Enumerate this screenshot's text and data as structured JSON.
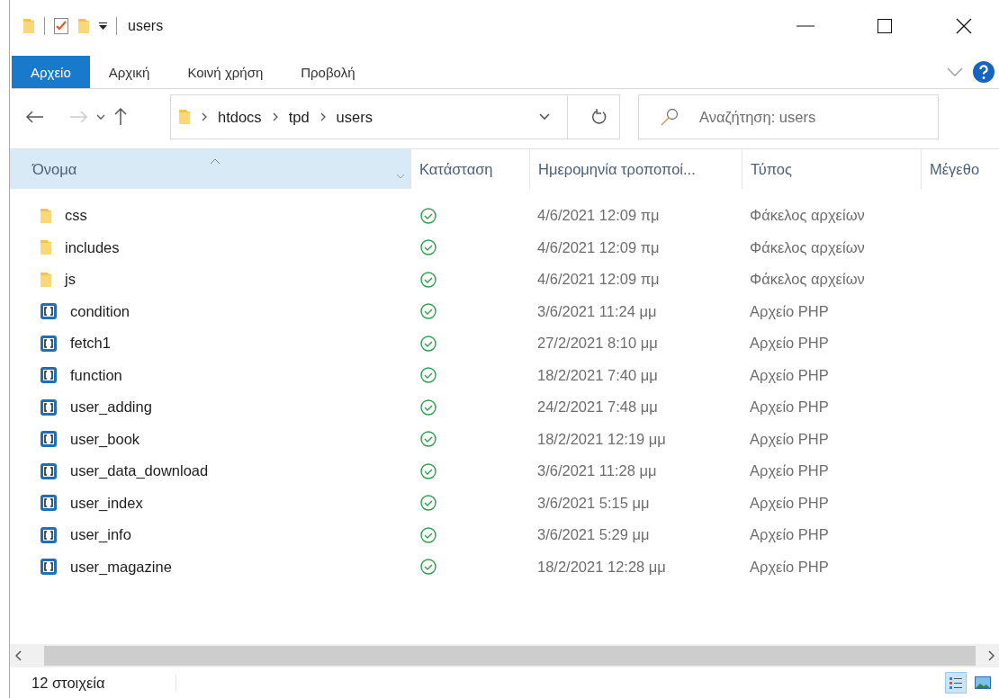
{
  "window": {
    "title": "users"
  },
  "ribbon": {
    "tabs": [
      {
        "label": "Αρχείο",
        "selected": true
      },
      {
        "label": "Αρχική",
        "selected": false
      },
      {
        "label": "Κοινή χρήση",
        "selected": false
      },
      {
        "label": "Προβολή",
        "selected": false
      }
    ]
  },
  "address_bar": {
    "path": [
      "htdocs",
      "tpd",
      "users"
    ]
  },
  "search": {
    "placeholder": "Αναζήτηση: users"
  },
  "table": {
    "columns": [
      {
        "label": "Όνομα",
        "sorted": true
      },
      {
        "label": "Κατάσταση",
        "sorted": false
      },
      {
        "label": "Ημερομηνία τροποποί...",
        "sorted": false
      },
      {
        "label": "Τύπος",
        "sorted": false
      },
      {
        "label": "Μέγεθο",
        "sorted": false
      }
    ],
    "rows": [
      {
        "name": "css",
        "kind": "folder",
        "date": "4/6/2021 12:09 πμ",
        "type": "Φάκελος αρχείων"
      },
      {
        "name": "includes",
        "kind": "folder",
        "date": "4/6/2021 12:09 πμ",
        "type": "Φάκελος αρχείων"
      },
      {
        "name": "js",
        "kind": "folder",
        "date": "4/6/2021 12:09 πμ",
        "type": "Φάκελος αρχείων"
      },
      {
        "name": "condition",
        "kind": "php",
        "date": "3/6/2021 11:24 μμ",
        "type": "Αρχείο PHP"
      },
      {
        "name": "fetch1",
        "kind": "php",
        "date": "27/2/2021 8:10 μμ",
        "type": "Αρχείο PHP"
      },
      {
        "name": "function",
        "kind": "php",
        "date": "18/2/2021 7:40 μμ",
        "type": "Αρχείο PHP"
      },
      {
        "name": "user_adding",
        "kind": "php",
        "date": "24/2/2021 7:48 μμ",
        "type": "Αρχείο PHP"
      },
      {
        "name": "user_book",
        "kind": "php",
        "date": "18/2/2021 12:19 μμ",
        "type": "Αρχείο PHP"
      },
      {
        "name": "user_data_download",
        "kind": "php",
        "date": "3/6/2021 11:28 μμ",
        "type": "Αρχείο PHP"
      },
      {
        "name": "user_index",
        "kind": "php",
        "date": "3/6/2021 5:15 μμ",
        "type": "Αρχείο PHP"
      },
      {
        "name": "user_info",
        "kind": "php",
        "date": "3/6/2021 5:29 μμ",
        "type": "Αρχείο PHP"
      },
      {
        "name": "user_magazine",
        "kind": "php",
        "date": "18/2/2021 12:28 μμ",
        "type": "Αρχείο PHP"
      }
    ]
  },
  "status_bar": {
    "count": "12 στοιχεία",
    "views": [
      {
        "kind": "details",
        "selected": true
      },
      {
        "kind": "large_icons",
        "selected": false
      }
    ]
  }
}
